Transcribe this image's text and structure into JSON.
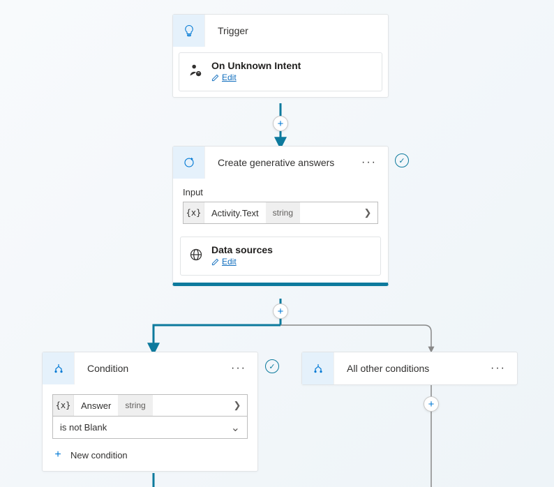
{
  "trigger": {
    "title": "Trigger",
    "sub": {
      "title": "On Unknown Intent",
      "edit": "Edit"
    }
  },
  "generative": {
    "title": "Create generative answers",
    "input_label": "Input",
    "input_var": "Activity.Text",
    "input_type": "string",
    "data_sources": {
      "title": "Data sources",
      "edit": "Edit"
    }
  },
  "condition": {
    "title": "Condition",
    "var": "Answer",
    "type": "string",
    "operator": "is not Blank",
    "new_condition": "New condition"
  },
  "alt_condition": {
    "title": "All other conditions"
  },
  "glyphs": {
    "fx": "{x}",
    "chevron_right": "❯",
    "chevron_down": "⌄",
    "plus": "+",
    "more": "···",
    "check": "✓"
  }
}
